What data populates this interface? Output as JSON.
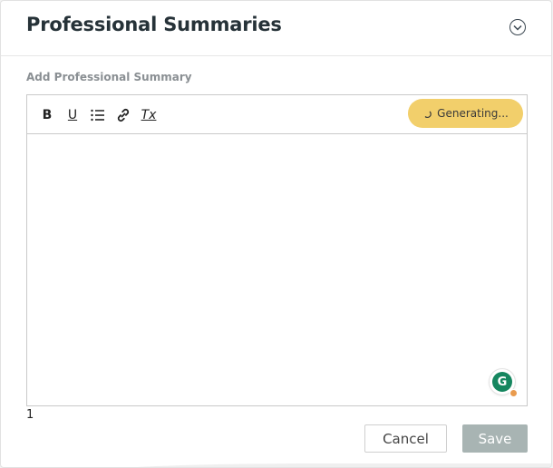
{
  "header": {
    "title": "Professional Summaries",
    "collapse_icon": "chevron-down-circle-icon"
  },
  "field": {
    "label": "Add Professional Summary",
    "value": "",
    "char_count": "1"
  },
  "toolbar": {
    "bold_icon": "B",
    "underline_icon": "U",
    "list_icon": "bulleted-list-icon",
    "link_icon": "link-icon",
    "clear_format_icon": "Tx",
    "generate_label": "Generating..."
  },
  "grammarly": {
    "letter": "G"
  },
  "actions": {
    "cancel_label": "Cancel",
    "save_label": "Save"
  },
  "colors": {
    "generate_bg": "#f2cf6b",
    "save_bg": "#a8b4b3",
    "grammarly_green": "#15865f",
    "title": "#263238"
  }
}
